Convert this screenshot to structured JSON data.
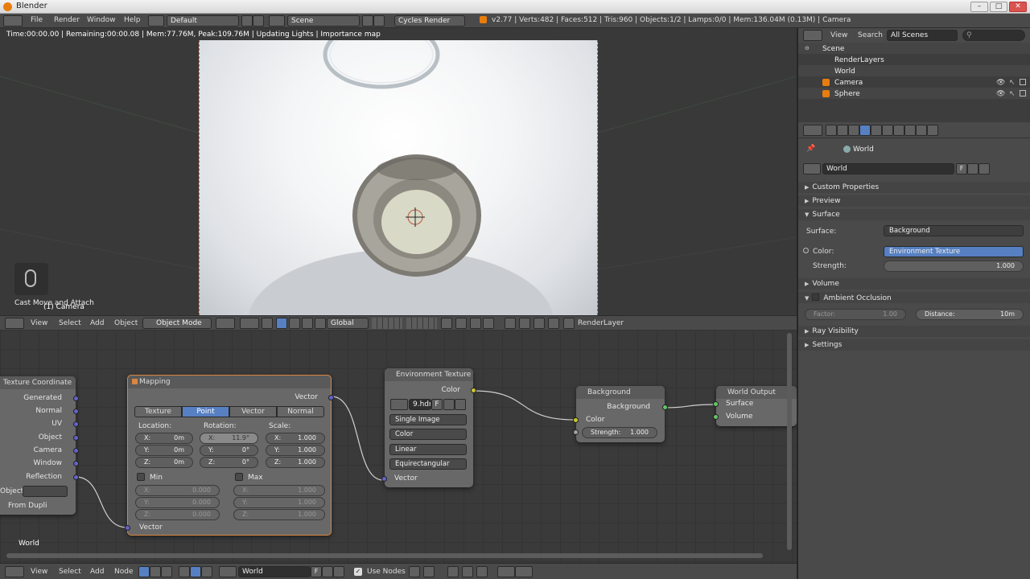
{
  "window": {
    "title": "Blender",
    "minimize": "–",
    "maximize": "□",
    "close": "✕"
  },
  "topbar": {
    "menus": [
      "File",
      "Render",
      "Window",
      "Help"
    ],
    "layout": "Default",
    "scene": "Scene",
    "engine": "Cycles Render",
    "stats": "v2.77 | Verts:482 | Faces:512 | Tris:960 | Objects:1/2 | Lamps:0/0 | Mem:136.04M (0.13M) | Camera"
  },
  "viewport": {
    "status": "Time:00:00.00 | Remaining:00:00.08 | Mem:77.76M, Peak:109.76M | Updating Lights | Importance map",
    "overlay1": "Cast Move and Attach",
    "overlay2": "(1) Camera"
  },
  "view3d_bar": {
    "menus": [
      "View",
      "Select",
      "Add",
      "Object"
    ],
    "mode": "Object Mode",
    "orientation": "Global",
    "layer": "RenderLayer"
  },
  "nodes": {
    "texcoord": {
      "title": "Texture Coordinate",
      "outputs": [
        "Generated",
        "Normal",
        "UV",
        "Object",
        "Camera",
        "Window",
        "Reflection"
      ],
      "object_label": "Object",
      "from_dupli": "From Dupli"
    },
    "mapping": {
      "title": "Mapping",
      "output": "Vector",
      "tabs": [
        "Texture",
        "Point",
        "Vector",
        "Normal"
      ],
      "active_tab": "Point",
      "location_label": "Location:",
      "rotation_label": "Rotation:",
      "scale_label": "Scale:",
      "loc": [
        {
          "k": "X:",
          "v": "0m"
        },
        {
          "k": "Y:",
          "v": "0m"
        },
        {
          "k": "Z:",
          "v": "0m"
        }
      ],
      "rot": [
        {
          "k": "X:",
          "v": "11.9°"
        },
        {
          "k": "Y:",
          "v": "0°"
        },
        {
          "k": "Z:",
          "v": "0°"
        }
      ],
      "scale": [
        {
          "k": "X:",
          "v": "1.000"
        },
        {
          "k": "Y:",
          "v": "1.000"
        },
        {
          "k": "Z:",
          "v": "1.000"
        }
      ],
      "min_label": "Min",
      "max_label": "Max",
      "min": [
        {
          "k": "X:",
          "v": "0.000"
        },
        {
          "k": "Y:",
          "v": "0.000"
        },
        {
          "k": "Z:",
          "v": "0.000"
        }
      ],
      "max": [
        {
          "k": "X:",
          "v": "1.000"
        },
        {
          "k": "Y:",
          "v": "1.000"
        },
        {
          "k": "Z:",
          "v": "1.000"
        }
      ],
      "input": "Vector"
    },
    "env": {
      "title": "Environment Texture",
      "output": "Color",
      "image": "9.hdr",
      "f": "F",
      "source": "Single Image",
      "colorspace": "Color",
      "interp": "Linear",
      "projection": "Equirectangular",
      "input": "Vector"
    },
    "bg": {
      "title": "Background",
      "output": "Background",
      "color_in": "Color",
      "strength_label": "Strength:",
      "strength": "1.000"
    },
    "out": {
      "title": "World Output",
      "surface": "Surface",
      "volume": "Volume"
    },
    "world_label": "World"
  },
  "node_bar": {
    "menus": [
      "View",
      "Select",
      "Add",
      "Node"
    ],
    "world": "World",
    "f": "F",
    "use_nodes": "Use Nodes"
  },
  "outliner": {
    "menus": [
      "View",
      "Search"
    ],
    "filter": "All Scenes",
    "items": [
      "Scene",
      "RenderLayers",
      "World",
      "Camera",
      "Sphere"
    ]
  },
  "props": {
    "breadcrumb": "World",
    "world_name": "World",
    "f": "F",
    "panels": {
      "custom": "Custom Properties",
      "preview": "Preview",
      "surface": "Surface",
      "volume": "Volume",
      "ao": "Ambient Occlusion",
      "ray": "Ray Visibility",
      "settings": "Settings"
    },
    "surface_label": "Surface:",
    "surface_value": "Background",
    "color_label": "Color:",
    "color_value": "Environment Texture",
    "strength_label": "Strength:",
    "strength_value": "1.000",
    "factor_label": "Factor:",
    "factor_value": "1.00",
    "distance_label": "Distance:",
    "distance_value": "10m"
  }
}
